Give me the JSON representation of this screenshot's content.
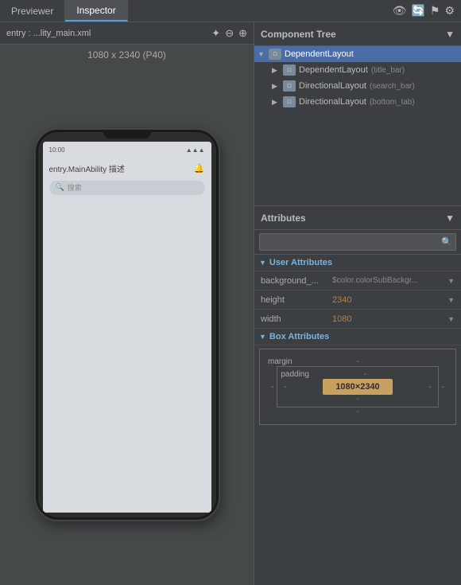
{
  "tabs": [
    {
      "label": "Previewer",
      "active": false
    },
    {
      "label": "Inspector",
      "active": true
    }
  ],
  "tab_icons": [
    "👁",
    "🔄",
    "🏴",
    "⚙"
  ],
  "file_bar": {
    "path": "entry : ...lity_main.xml",
    "icons": [
      "✨",
      "−",
      "+"
    ]
  },
  "device_label": "1080 x 2340 (P40)",
  "phone": {
    "title": "entry.MainAbility  描述",
    "search_placeholder": "搜索"
  },
  "component_tree": {
    "title": "Component Tree",
    "items": [
      {
        "level": 0,
        "expand": true,
        "name": "DependentLayout",
        "sub": "",
        "selected": true
      },
      {
        "level": 1,
        "expand": true,
        "name": "DependentLayout",
        "sub": "(title_bar)",
        "selected": false
      },
      {
        "level": 1,
        "expand": false,
        "name": "DirectionalLayout",
        "sub": "(search_bar)",
        "selected": false
      },
      {
        "level": 1,
        "expand": false,
        "name": "DirectionalLayout",
        "sub": "(bottom_tab)",
        "selected": false
      }
    ]
  },
  "attributes": {
    "title": "Attributes",
    "search_placeholder": "",
    "search_icon": "🔍",
    "user_group_title": "User Attributes",
    "rows": [
      {
        "name": "background_...",
        "value": "$color.colorSubBackgr...",
        "dropdown": true
      },
      {
        "name": "height",
        "value": "2340",
        "dropdown": true
      },
      {
        "name": "width",
        "value": "1080",
        "dropdown": true
      }
    ],
    "box_group_title": "Box Attributes",
    "box": {
      "margin_label": "margin",
      "margin_dash": "-",
      "padding_label": "padding",
      "padding_dash": "-",
      "inner_value": "1080×2340",
      "top_dash": "-",
      "bottom_dash": "-",
      "left_dash": "-",
      "right_dash": "-",
      "outer_left": "-",
      "outer_right": "-"
    }
  }
}
